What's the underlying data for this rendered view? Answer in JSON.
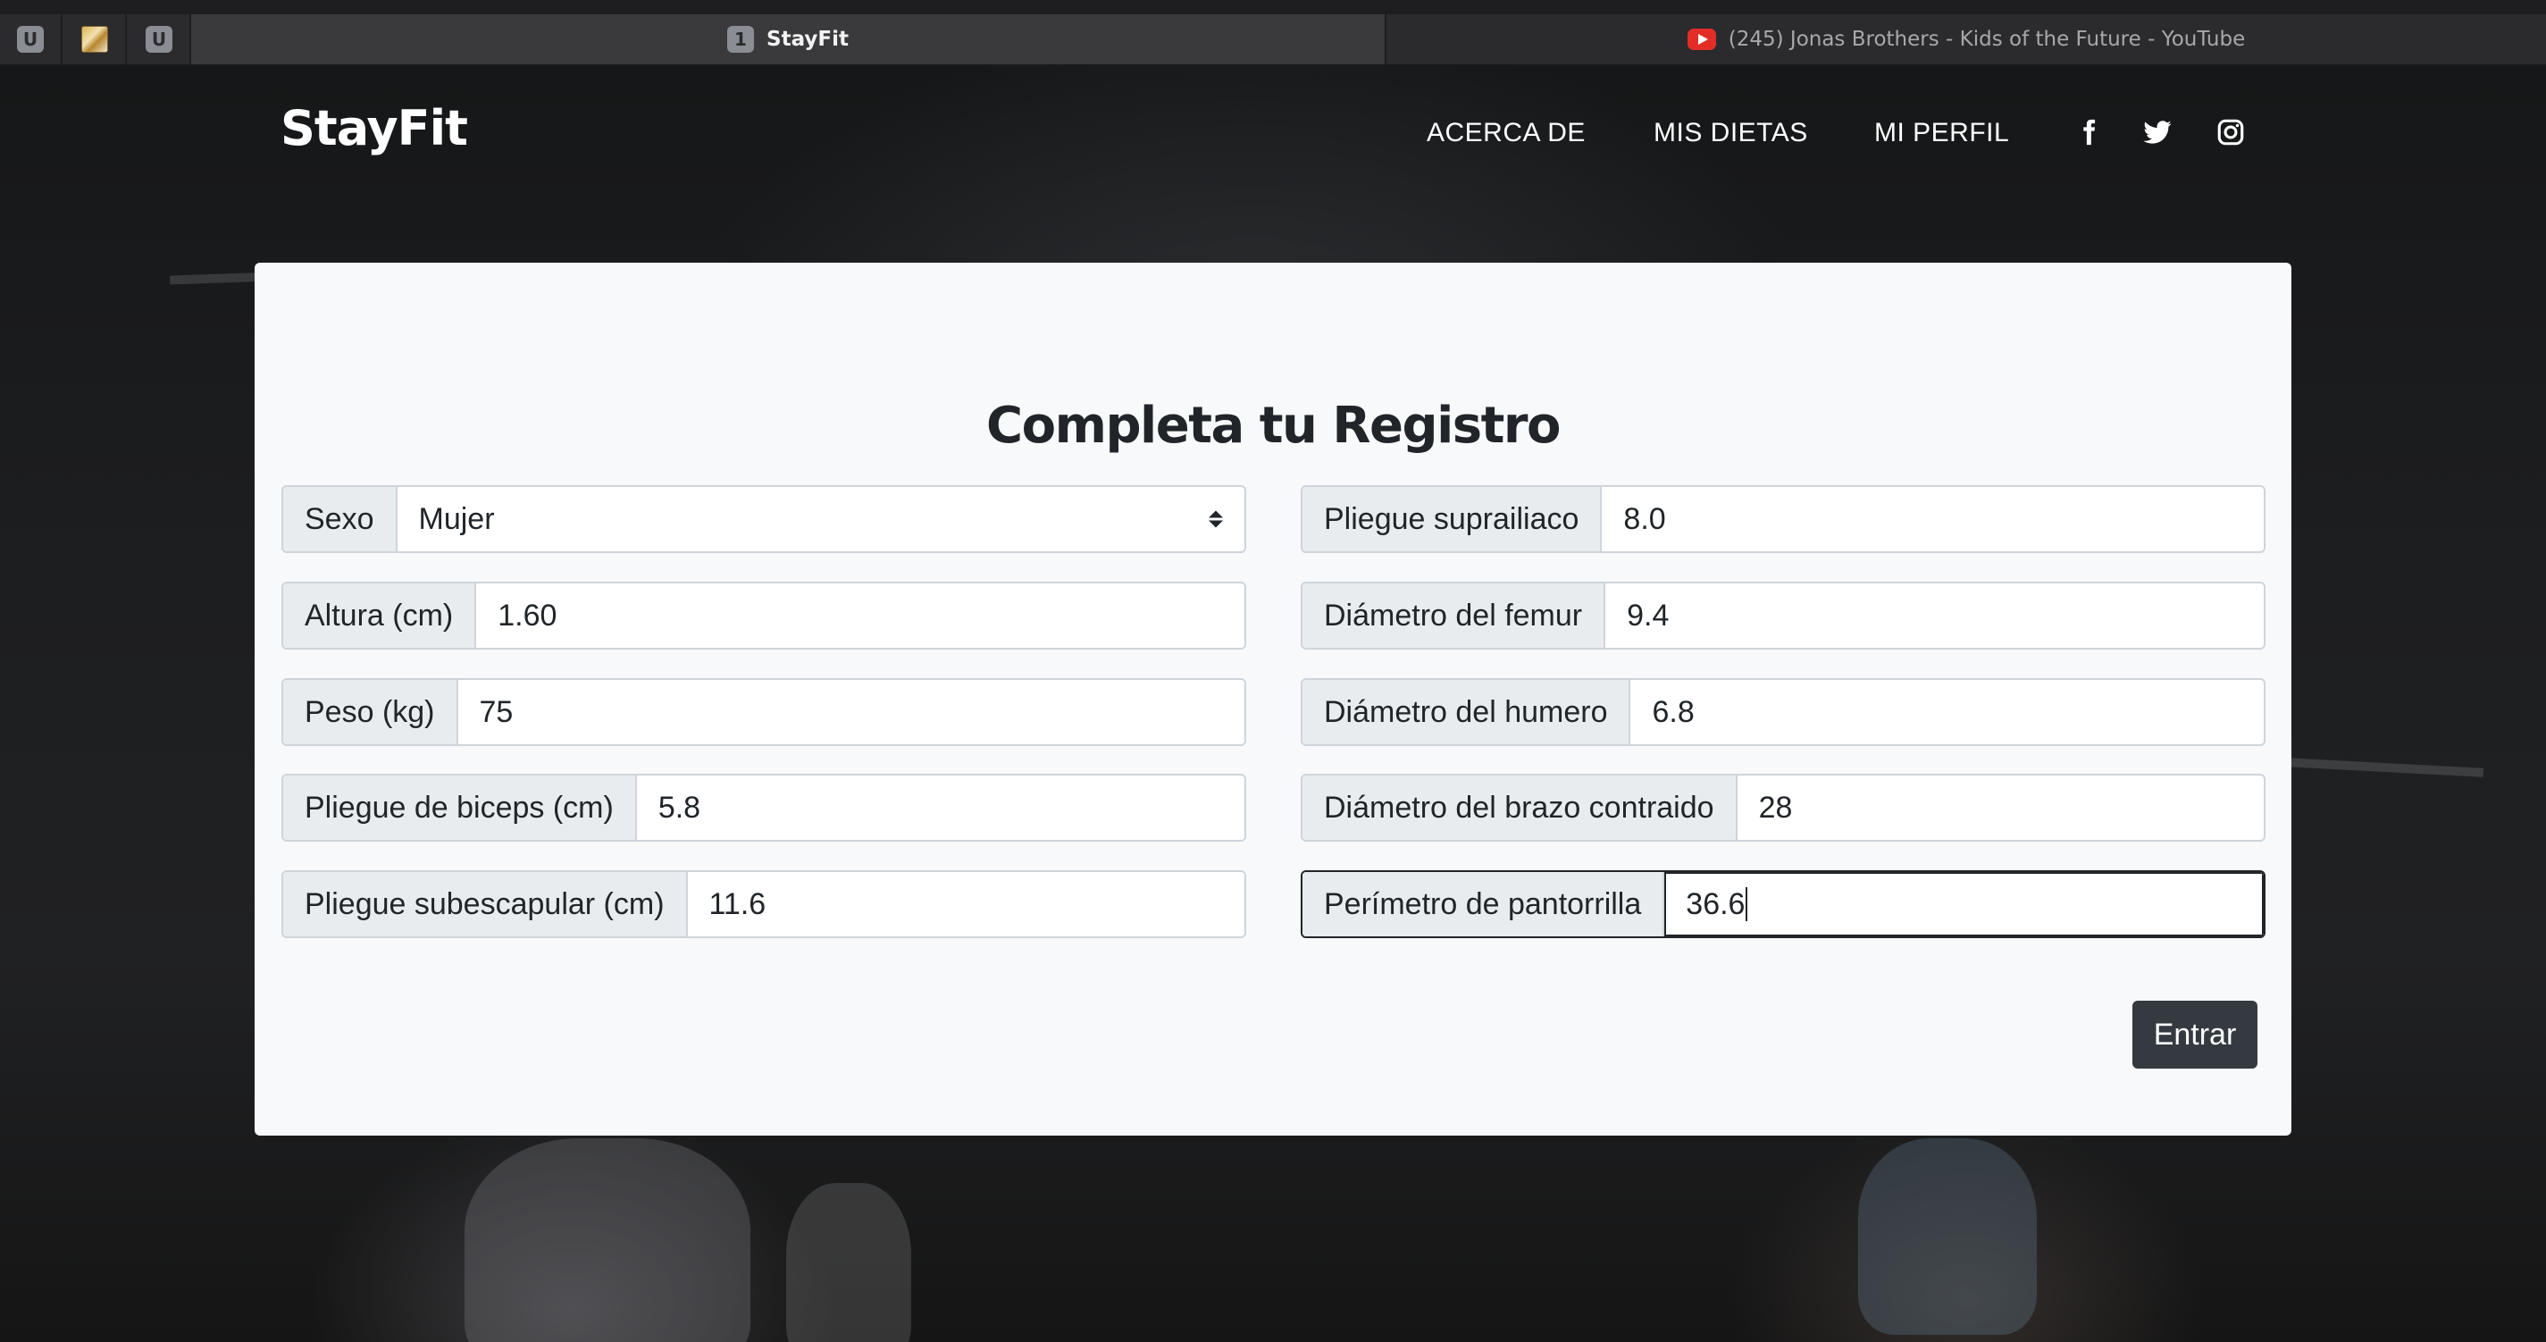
{
  "browser": {
    "pinned_tabs": [
      {
        "icon": "u-badge-icon",
        "label": "U"
      },
      {
        "icon": "image-thumbnail-icon",
        "label": ""
      },
      {
        "icon": "u-badge-icon",
        "label": "U"
      }
    ],
    "active_tab": {
      "number": "1",
      "title": "StayFit"
    },
    "other_tab": {
      "title": "(245) Jonas Brothers - Kids of the Future - YouTube",
      "icon": "youtube-icon"
    }
  },
  "navbar": {
    "brand": "StayFit",
    "links": [
      "ACERCA DE",
      "MIS DIETAS",
      "MI PERFIL"
    ],
    "social_icons": [
      "facebook-icon",
      "twitter-icon",
      "instagram-icon"
    ]
  },
  "form": {
    "title": "Completa tu Registro",
    "left": [
      {
        "label": "Sexo",
        "value": "Mujer",
        "type": "select"
      },
      {
        "label": "Altura (cm)",
        "value": "1.60"
      },
      {
        "label": "Peso (kg)",
        "value": "75"
      },
      {
        "label": "Pliegue de biceps (cm)",
        "value": "5.8"
      },
      {
        "label": "Pliegue subescapular (cm)",
        "value": "11.6"
      }
    ],
    "right": [
      {
        "label": "Pliegue suprailiaco",
        "value": "8.0"
      },
      {
        "label": "Diámetro del femur",
        "value": "9.4"
      },
      {
        "label": "Diámetro del humero",
        "value": "6.8"
      },
      {
        "label": "Diámetro del brazo contraido",
        "value": "28"
      },
      {
        "label": "Perímetro de pantorrilla",
        "value": "36.6",
        "focused": true
      }
    ],
    "submit_label": "Entrar"
  },
  "colors": {
    "card_bg": "#f8f9fa",
    "label_bg": "#e9ecef",
    "button_bg": "#343a40",
    "page_bg": "#1d1e20"
  }
}
